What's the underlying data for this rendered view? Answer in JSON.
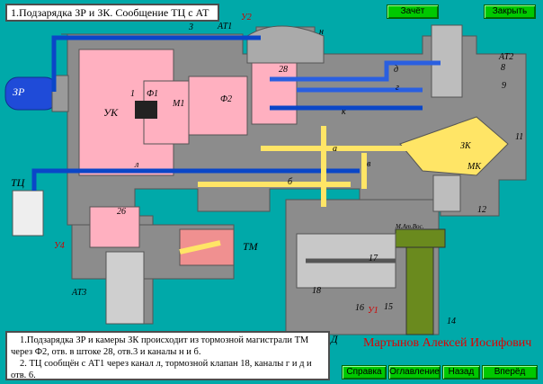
{
  "title": "1.Подзарядка ЗР и ЗК. Сообщение ТЦ с АТ",
  "buttons": {
    "zachet": "Зачёт",
    "close": "Закрыть",
    "help": "Справка",
    "contents": "Оглавление",
    "back": "Назад",
    "forward": "Вперёд"
  },
  "description": {
    "p1": "1.Подзарядка ЗР и камеры ЗК происходит из тормозной  магистрали ТМ через Ф2, отв. в штоке 28, отв.3 и каналы н и б.",
    "p2": "2. ТЦ сообщён с АТ1 через канал  л, тормозной клапан 18, каналы г и д  и отв. 6."
  },
  "author": "Мартынов Алексей Иосифович",
  "labels": {
    "zr": "ЗР",
    "uk": "УК",
    "f1": "Ф1",
    "one": "1",
    "m1": "М1",
    "f2": "Ф2",
    "three": "3",
    "u2": "У2",
    "at1": "АТ1",
    "n": "н",
    "n28": "28",
    "d": "д",
    "g": "г",
    "k": "к",
    "a": "а",
    "l": "л",
    "b": "б",
    "v": "в",
    "at2": "АТ2",
    "n8": "8",
    "n9": "9",
    "zk": "ЗК",
    "mk": "МК",
    "n11": "11",
    "n12": "12",
    "tc": "ТЦ",
    "u4": "У4",
    "n26": "26",
    "tm": "ТМ",
    "at3": "АТ3",
    "maa": "М.Ат.Вос.",
    "n17": "17",
    "n18": "18",
    "n16": "16",
    "n15": "15",
    "u1": "У1",
    "n14": "14",
    "dd": "Д"
  },
  "colors": {
    "background": "#00a9a9",
    "body": "#8c8c8c",
    "button": "#00c800",
    "author": "#e00000"
  }
}
